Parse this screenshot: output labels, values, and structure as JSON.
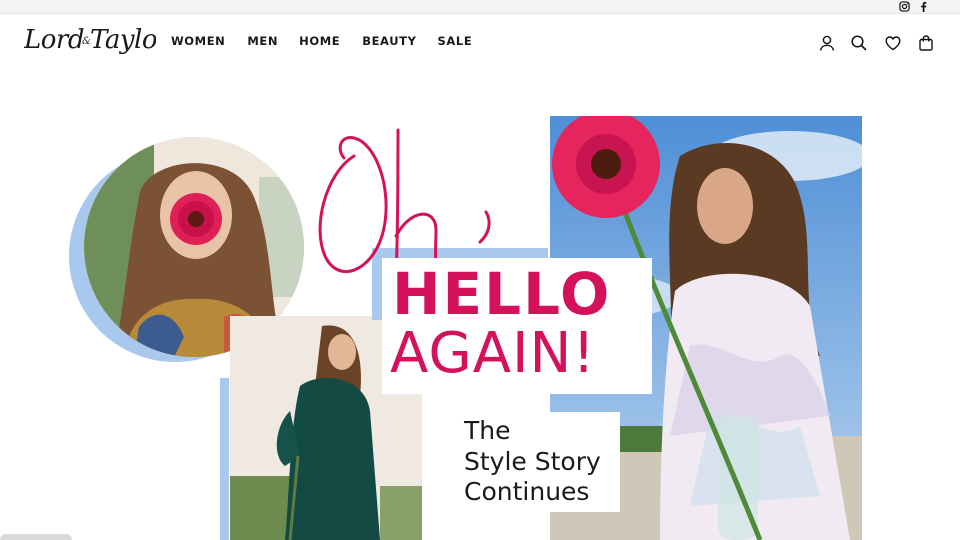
{
  "brand": {
    "logo_text": "Lord & Taylor"
  },
  "social": {
    "icons": [
      "instagram-icon",
      "facebook-icon"
    ]
  },
  "nav": {
    "items": [
      {
        "label": "WOMEN"
      },
      {
        "label": "MEN"
      },
      {
        "label": "HOME"
      },
      {
        "label": "BEAUTY"
      },
      {
        "label": "SALE"
      }
    ]
  },
  "header_icons": [
    "account-icon",
    "search-icon",
    "wishlist-heart-icon",
    "shopping-bag-icon"
  ],
  "hero": {
    "script_text": "Oh,",
    "headline_1": "HELLO",
    "headline_2": "AGAIN!",
    "subline_1": "The",
    "subline_2": "Style Story",
    "subline_3": "Continues"
  },
  "colors": {
    "accent_pink": "#d4125c",
    "accent_blue": "#a9c8ee",
    "text": "#1a1a1a"
  }
}
